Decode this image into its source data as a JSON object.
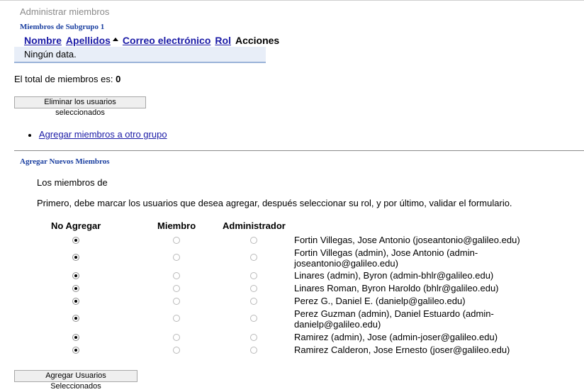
{
  "page_title": "Administrar miembros",
  "subgroup": {
    "title": "Miembros de Subgrupo 1",
    "columns": {
      "nombre": "Nombre",
      "apellidos": "Apellidos",
      "correo": "Correo electrónico",
      "rol": "Rol",
      "acciones": "Acciones"
    },
    "empty_text": "Ningún data."
  },
  "total": {
    "label": "El total de miembros es:",
    "value": "0"
  },
  "delete_button": "Eliminar los usuarios seleccionados",
  "add_to_group_link": "Agregar miembros a otro grupo",
  "new_members": {
    "title": "Agregar Nuevos Miembros",
    "members_of": "Los miembros de",
    "instructions": "Primero, debe marcar los usuarios que desea agregar, después seleccionar su rol, y por último, validar el formulario.",
    "headers": {
      "no_add": "No Agregar",
      "member": "Miembro",
      "admin": "Administrador"
    },
    "users": [
      {
        "label": "Fortin Villegas, Jose Antonio (joseantonio@galileo.edu)",
        "selected": "no_add"
      },
      {
        "label": "Fortin Villegas (admin), Jose Antonio (admin-joseantonio@galileo.edu)",
        "selected": "no_add"
      },
      {
        "label": "Linares (admin), Byron (admin-bhlr@galileo.edu)",
        "selected": "no_add"
      },
      {
        "label": "Linares Roman, Byron Haroldo (bhlr@galileo.edu)",
        "selected": "no_add"
      },
      {
        "label": "Perez G., Daniel E. (danielp@galileo.edu)",
        "selected": "no_add"
      },
      {
        "label": "Perez Guzman (admin), Daniel Estuardo (admin-danielp@galileo.edu)",
        "selected": "no_add"
      },
      {
        "label": "Ramirez (admin), Jose (admin-joser@galileo.edu)",
        "selected": "no_add"
      },
      {
        "label": "Ramirez Calderon, Jose Ernesto (joser@galileo.edu)",
        "selected": "no_add"
      }
    ],
    "submit_button": "Agregar Usuarios Seleccionados"
  }
}
